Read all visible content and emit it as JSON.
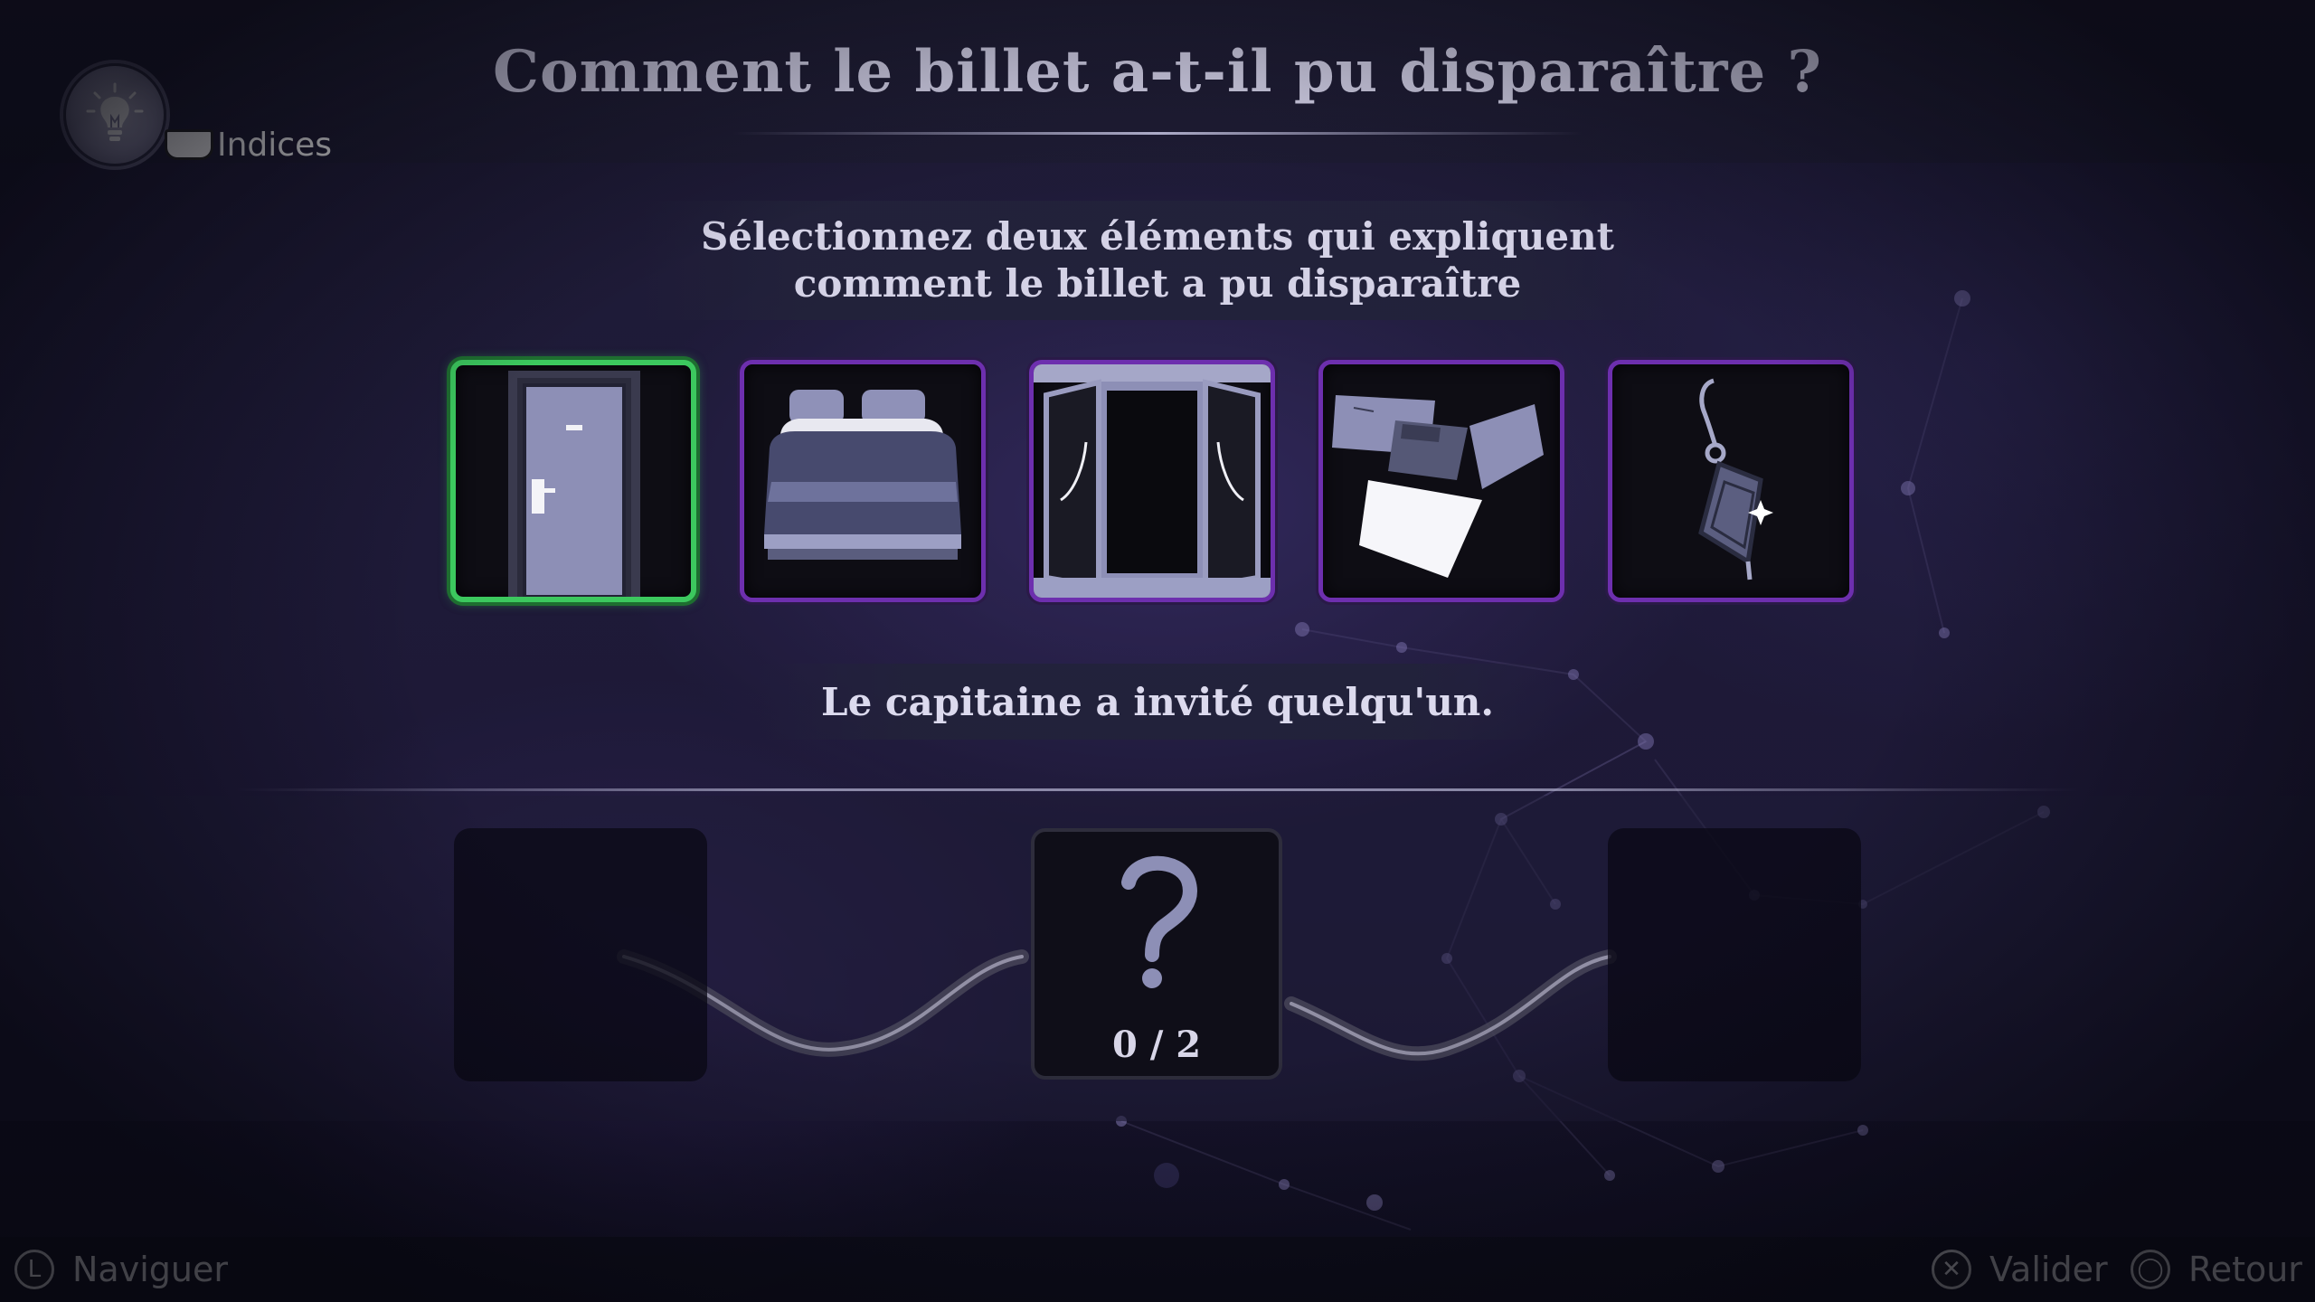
{
  "header": {
    "title": "Comment le billet a-t-il pu disparaître ?"
  },
  "hints": {
    "label": "Indices",
    "icon": "lightbulb-icon"
  },
  "instruction": {
    "line1": "Sélectionnez deux éléments qui expliquent",
    "line2": "comment le billet a pu disparaître"
  },
  "cards": [
    {
      "id": "door",
      "icon": "door-icon",
      "selected": true
    },
    {
      "id": "bed",
      "icon": "bed-icon",
      "selected": false
    },
    {
      "id": "window",
      "icon": "window-icon",
      "selected": false
    },
    {
      "id": "papers",
      "icon": "papers-icon",
      "selected": false
    },
    {
      "id": "pendant",
      "icon": "pendant-icon",
      "selected": false
    }
  ],
  "caption": "Le capitaine a invité quelqu'un.",
  "selection": {
    "counter": "0 / 2",
    "placeholder_icon": "question-mark-icon"
  },
  "controls": {
    "navigate": {
      "glyph": "L",
      "label": "Naviguer"
    },
    "confirm": {
      "glyph": "✕",
      "label": "Valider"
    },
    "back": {
      "glyph": "◯",
      "label": "Retour"
    }
  },
  "colors": {
    "selected_border": "#3cc85e",
    "card_border": "#6d2fae",
    "background": "#1b1834"
  }
}
